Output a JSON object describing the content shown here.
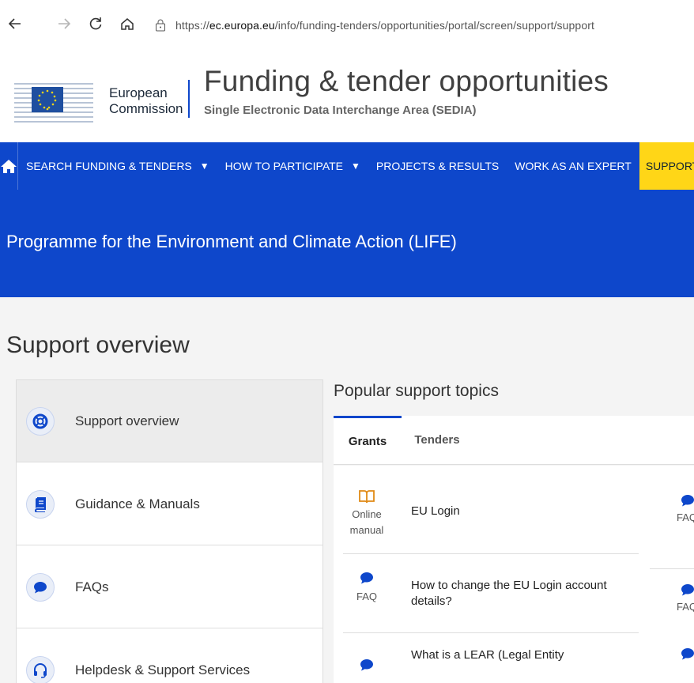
{
  "browser": {
    "url_prefix": "https://",
    "url_host": "ec.europa.eu",
    "url_path": "/info/funding-tenders/opportunities/portal/screen/support/support"
  },
  "header": {
    "ec_line1": "European",
    "ec_line2": "Commission",
    "title": "Funding & tender opportunities",
    "subtitle": "Single Electronic Data Interchange Area (SEDIA)"
  },
  "nav": {
    "items": [
      {
        "label": "SEARCH FUNDING & TENDERS",
        "caret": "▼"
      },
      {
        "label": "HOW TO PARTICIPATE",
        "caret": "▼"
      },
      {
        "label": "PROJECTS & RESULTS",
        "caret": ""
      },
      {
        "label": "WORK AS AN EXPERT",
        "caret": ""
      },
      {
        "label": "SUPPORT",
        "caret": "▼"
      }
    ]
  },
  "banner": {
    "title": "Programme for the Environment and Climate Action (LIFE)"
  },
  "page": {
    "title": "Support overview"
  },
  "side_menu": {
    "items": [
      {
        "label": "Support overview",
        "icon": "lifebuoy-icon"
      },
      {
        "label": "Guidance & Manuals",
        "icon": "book-icon"
      },
      {
        "label": "FAQs",
        "icon": "chat-bubble-icon"
      },
      {
        "label": "Helpdesk & Support Services",
        "icon": "headset-icon"
      }
    ]
  },
  "topics": {
    "title": "Popular support topics",
    "tabs": [
      {
        "label": "Grants"
      },
      {
        "label": "Tenders"
      }
    ],
    "list": [
      {
        "type_line1": "Online",
        "type_line2": "manual",
        "text": "EU Login",
        "icon": "open-book-icon"
      },
      {
        "type_line1": "FAQ",
        "type_line2": "",
        "text": "How to change the EU Login account details?",
        "icon": "chat-bubble-icon"
      },
      {
        "type_line1": "",
        "type_line2": "",
        "text": "What is a LEAR (Legal Entity",
        "icon": "chat-bubble-icon"
      }
    ],
    "right_col": [
      {
        "label": "FAQ"
      },
      {
        "label": "FAQ"
      },
      {
        "label": ""
      }
    ]
  },
  "colors": {
    "brand_blue": "#0e47cb",
    "active_yellow": "#ffd617",
    "icon_orange": "#e08a16"
  }
}
